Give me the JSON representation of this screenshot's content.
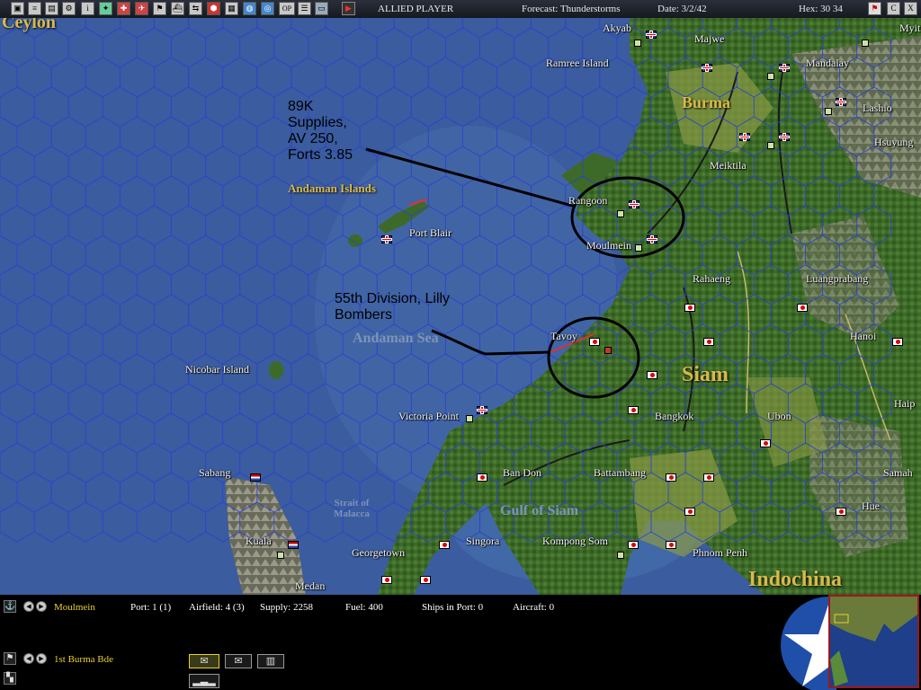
{
  "topbar": {
    "buttons": [
      "save-icon",
      "log-icon",
      "report-icon",
      "settings-icon",
      "info-icon",
      "air-icon",
      "ground-icon",
      "aircraft-icon",
      "flag-icon",
      "ship-icon",
      "path-icon",
      "hex-icon",
      "city-icon",
      "globe-icon",
      "op-icon",
      "list-icon",
      "map-icon"
    ],
    "op_label": "OP",
    "player": "ALLIED PLAYER",
    "forecast": "Forecast: Thunderstorms",
    "date": "Date: 3/2/42",
    "hex": "Hex: 30 34",
    "right_buttons": [
      "flag-icon",
      "C",
      "X"
    ]
  },
  "map": {
    "regions": {
      "ceylon": "Ceylon",
      "burma": "Burma",
      "siam": "Siam",
      "indochina": "Indochina"
    },
    "seas": {
      "andaman_sea": "Andaman Sea",
      "gulf_of_siam": "Gulf of Siam",
      "strait_of_malacca": "Strait of Malacca"
    },
    "islands": {
      "andaman_islands": "Andaman Islands"
    },
    "places": [
      {
        "id": "akyab",
        "name": "Akyab"
      },
      {
        "id": "majwe",
        "name": "Majwe"
      },
      {
        "id": "myitkyina",
        "name": "Myitk"
      },
      {
        "id": "ramree",
        "name": "Ramree Island"
      },
      {
        "id": "mandalay",
        "name": "Mandalay"
      },
      {
        "id": "lashio",
        "name": "Lashio"
      },
      {
        "id": "hsuyung",
        "name": "Hsuyung"
      },
      {
        "id": "meiktila",
        "name": "Meiktila"
      },
      {
        "id": "rangoon",
        "name": "Rangoon"
      },
      {
        "id": "port_blair",
        "name": "Port Blair"
      },
      {
        "id": "moulmein",
        "name": "Moulmein"
      },
      {
        "id": "rahaeng",
        "name": "Rahaeng"
      },
      {
        "id": "luangprabang",
        "name": "Luangprabang"
      },
      {
        "id": "tavoy",
        "name": "Tavoy"
      },
      {
        "id": "hanoi",
        "name": "Hanoi"
      },
      {
        "id": "nicobar",
        "name": "Nicobar Island"
      },
      {
        "id": "haiphong",
        "name": "Haip"
      },
      {
        "id": "bangkok",
        "name": "Bangkok"
      },
      {
        "id": "ubon",
        "name": "Ubon"
      },
      {
        "id": "victoria_point",
        "name": "Victoria Point"
      },
      {
        "id": "sabang",
        "name": "Sabang"
      },
      {
        "id": "ban_don",
        "name": "Ban Don"
      },
      {
        "id": "battambang",
        "name": "Battambang"
      },
      {
        "id": "samah",
        "name": "Samah"
      },
      {
        "id": "hue",
        "name": "Hue"
      },
      {
        "id": "singora",
        "name": "Singora"
      },
      {
        "id": "kompong_som",
        "name": "Kompong Som"
      },
      {
        "id": "kuala",
        "name": "Kuala"
      },
      {
        "id": "georgetown",
        "name": "Georgetown"
      },
      {
        "id": "phnom_penh",
        "name": "Phnom Penh"
      },
      {
        "id": "medan",
        "name": "Medan"
      }
    ],
    "annotations": [
      {
        "id": "rangoon_note",
        "lines": [
          "89K",
          "Supplies,",
          "AV 250,",
          "Forts 3.85"
        ]
      },
      {
        "id": "tavoy_note",
        "lines": [
          "55th Division, Lilly",
          "Bombers"
        ]
      }
    ]
  },
  "bottom": {
    "base": {
      "name": "Moulmein",
      "port": "Port: 1 (1)",
      "airfield": "Airfield: 4 (3)",
      "supply": "Supply: 2258",
      "fuel": "Fuel: 400",
      "ships": "Ships in Port: 0",
      "aircraft": "Aircraft: 0"
    },
    "unit": {
      "name": "1st Burma Bde"
    },
    "taskforce_buttons": [
      "envelope-icon",
      "envelope-icon",
      "building-icon",
      "formation-icon"
    ]
  },
  "colors": {
    "sea": "#3b5c9e",
    "land": "#3f6b2a",
    "grid": "#2a3fd6",
    "label_gold": "#d9b94a",
    "annotation": "#000000",
    "minimap_border": "#a0171a"
  }
}
